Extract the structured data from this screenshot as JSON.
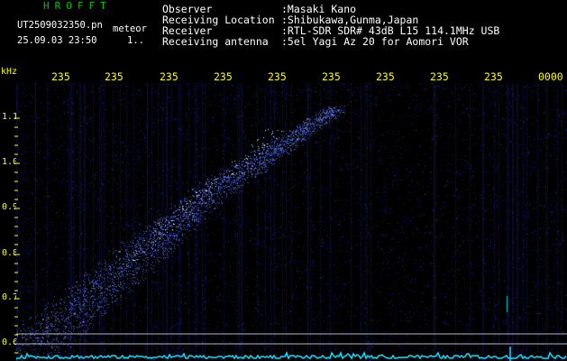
{
  "header": {
    "title": "HROFFT",
    "file_name": "UT2509032350.pn",
    "tag": "meteor",
    "datetime": "25.09.03 23:50",
    "count": "1..",
    "info": [
      {
        "label": "Observer",
        "value": ":Masaki Kano"
      },
      {
        "label": "Receiving Location",
        "value": ":Shibukawa,Gunma,Japan"
      },
      {
        "label": "Receiver",
        "value": ":RTL-SDR SDR# 43dB L15 114.1MHz USB"
      },
      {
        "label": "Receiving antenna",
        "value": ":5el Yagi Az 20 for Aomori VOR"
      }
    ]
  },
  "axis": {
    "y_unit": "kHz",
    "y_ticks": [
      "1.1",
      "1.0",
      "0.9",
      "0.8",
      "0.7",
      "0.6"
    ],
    "x_ticks": [
      "235",
      "235",
      "235",
      "235",
      "235",
      "235",
      "235",
      "235",
      "235",
      "0000"
    ]
  },
  "colors": {
    "title": "#00c800",
    "text": "#ffffff",
    "label": "#ffff00",
    "noise": "#3030c8",
    "trail": "#6a7cff",
    "guide": "#b4b4c8",
    "baseline": "#00e5ff"
  }
}
